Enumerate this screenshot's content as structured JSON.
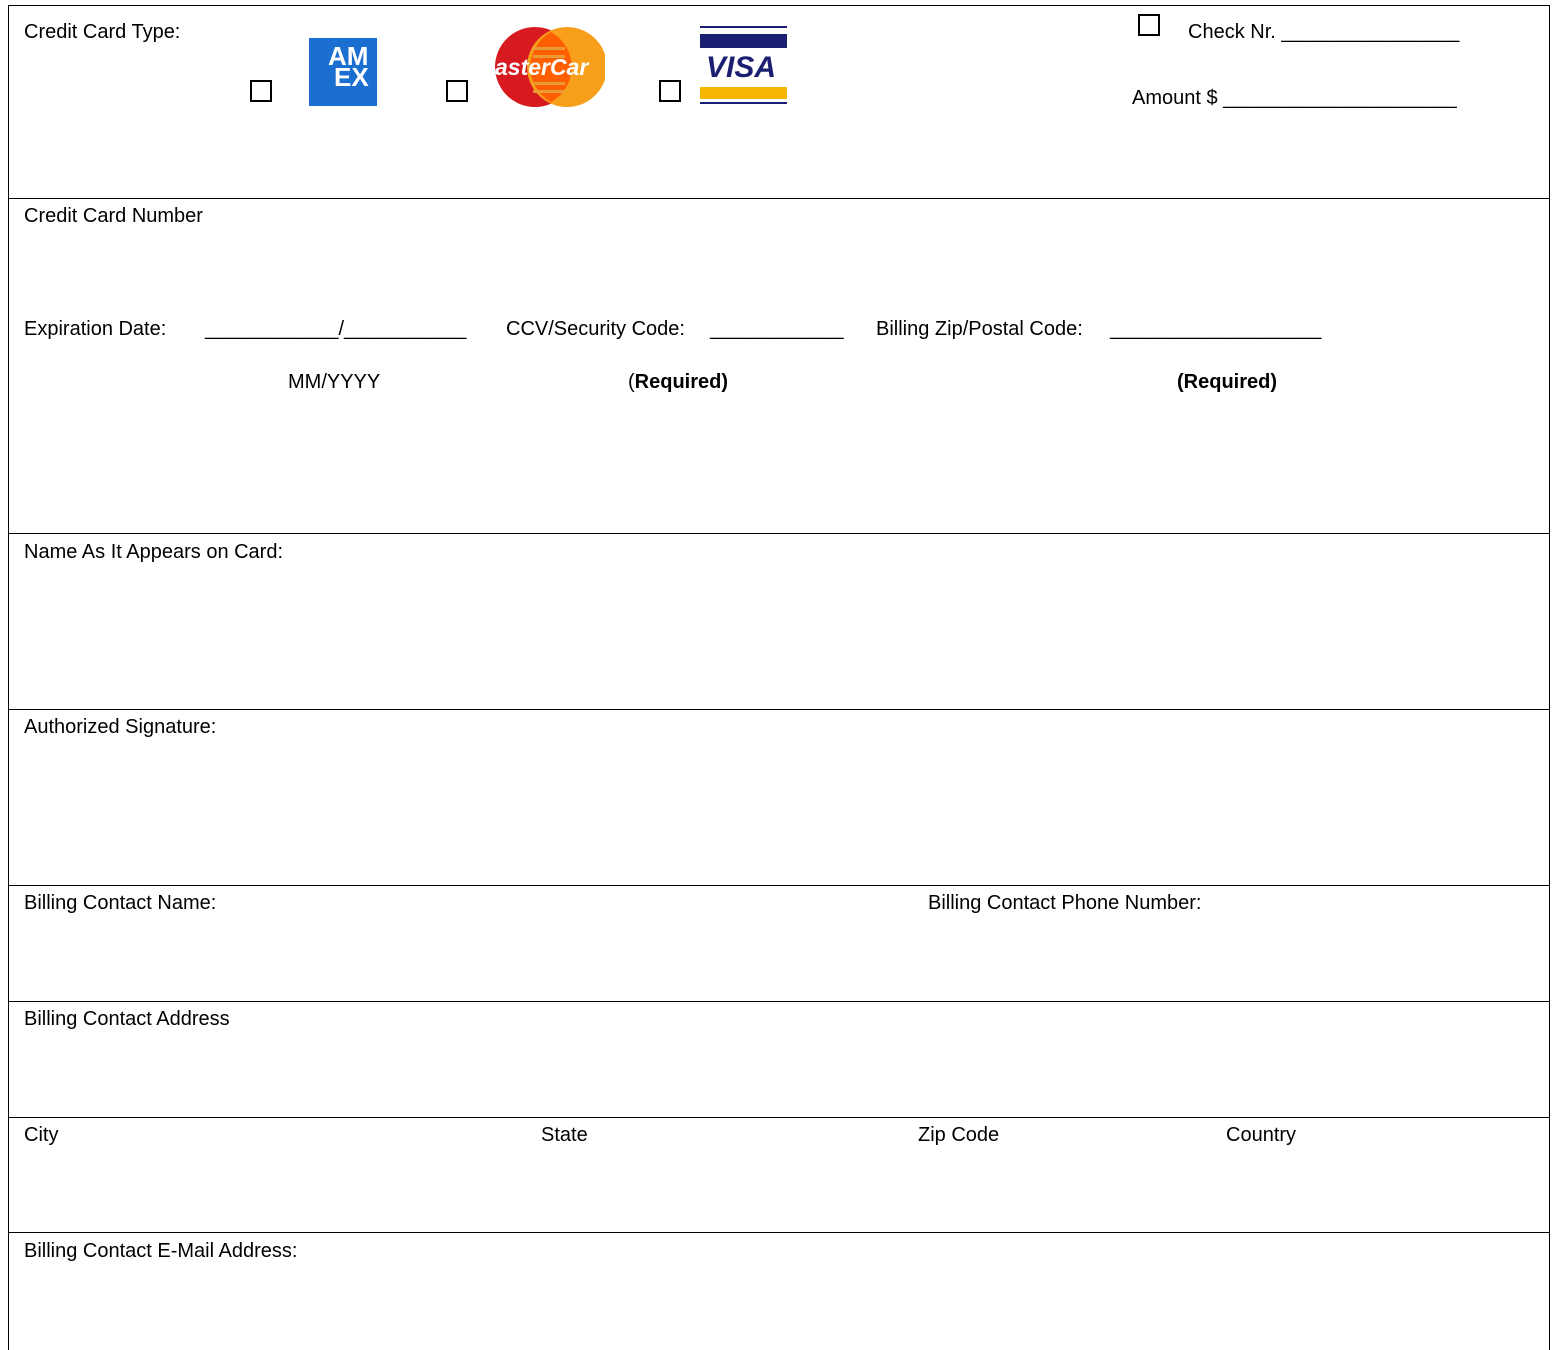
{
  "section1": {
    "card_type_label": "Credit Card Type:",
    "check_nr_label": "Check Nr. ________________",
    "amount_label": "Amount $ _____________________",
    "amex_logo_text_top": "AM",
    "amex_logo_text_bottom": "EX",
    "mastercard_logo_text": "asterCar",
    "visa_logo_text": "VISA"
  },
  "section2": {
    "card_number_label": "Credit Card Number",
    "expiration_label": "Expiration Date:",
    "expiration_blanks": "____________/___________",
    "ccv_label": "CCV/Security Code:",
    "ccv_blank": "____________",
    "zip_label": "Billing Zip/Postal Code:",
    "zip_blank": "___________________",
    "mm_yyyy": "MM/YYYY",
    "required_open": "(",
    "required_bold": "Required)",
    "required_full": "(Required)"
  },
  "section3": {
    "name_label": "Name As It Appears on Card:"
  },
  "section4": {
    "signature_label": "Authorized Signature:"
  },
  "section5": {
    "contact_name_label": "Billing Contact Name:",
    "contact_phone_label": "Billing Contact Phone Number:"
  },
  "section6": {
    "address_label": "Billing Contact Address"
  },
  "section7": {
    "city_label": "City",
    "state_label": "State",
    "zip_code_label": "Zip Code",
    "country_label": "Country"
  },
  "section8": {
    "email_label": "Billing Contact E-Mail Address:"
  },
  "colors": {
    "amex_blue": "#1a6fd0",
    "mastercard_red": "#d71920",
    "mastercard_orange": "#f79e1b",
    "visa_blue": "#1a1f71",
    "visa_gold": "#f7b600"
  }
}
